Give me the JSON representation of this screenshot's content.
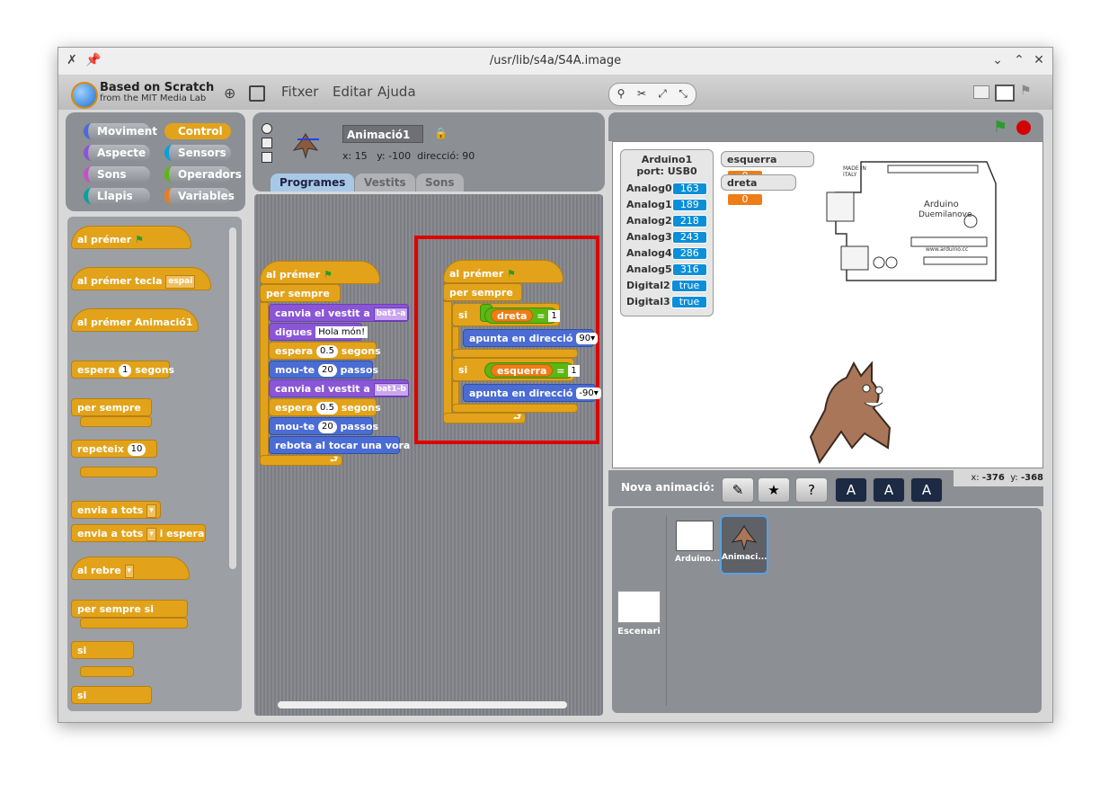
{
  "window": {
    "title": "/usr/lib/s4a/S4A.image"
  },
  "menu": {
    "brand_line1": "Based on Scratch",
    "brand_line2": "from the MIT Media Lab",
    "file": "Fitxer",
    "edit": "Editar",
    "help": "Ajuda"
  },
  "categories": {
    "motion": "Moviment",
    "control": "Control",
    "looks": "Aspecte",
    "sensing": "Sensors",
    "sound": "Sons",
    "operators": "Operadors",
    "pen": "Llapis",
    "variables": "Variables"
  },
  "palette": {
    "when_flag": "al prémer",
    "when_key": "al prémer tecla",
    "when_key_value": "espai",
    "when_clicked": "al prémer  Animació1",
    "wait_a": "espera",
    "wait_n": "1",
    "wait_b": "segons",
    "forever": "per sempre",
    "repeat": "repeteix",
    "repeat_n": "10",
    "broadcast": "envia a tots",
    "broadcast_wait_b": "i espera",
    "when_receive": "al rebre",
    "forever_if": "per sempre si",
    "if": "si"
  },
  "sprite_info": {
    "name": "Animació1",
    "x_label": "x:",
    "x": "15",
    "y_label": "y:",
    "y": "-100",
    "dir_label": "direcció:",
    "direction": "90"
  },
  "tabs": {
    "scripts": "Programes",
    "costumes": "Vestits",
    "sounds": "Sons"
  },
  "script1": {
    "hat": "al prémer",
    "forever": "per sempre",
    "costume1_a": "canvia el vestit a",
    "costume1_v": "bat1-a",
    "say_a": "digues",
    "say_v": "Hola món!",
    "wait1_a": "espera",
    "wait1_v": "0.5",
    "wait1_b": "segons",
    "move1_a": "mou-te",
    "move1_v": "20",
    "move1_b": "passos",
    "costume2_a": "canvia el vestit a",
    "costume2_v": "bat1-b",
    "wait2_a": "espera",
    "wait2_v": "0.5",
    "wait2_b": "segons",
    "move2_a": "mou-te",
    "move2_v": "20",
    "move2_b": "passos",
    "bounce": "rebota al tocar una vora"
  },
  "script2": {
    "hat": "al prémer",
    "forever": "per sempre",
    "if1": "si",
    "var1": "dreta",
    "eq1": "=",
    "val1": "1",
    "point1_a": "apunta en direcció",
    "point1_v": "90",
    "if2": "si",
    "var2": "esquerra",
    "eq2": "=",
    "val2": "1",
    "point2_a": "apunta en direcció",
    "point2_v": "-90"
  },
  "arduino_monitor": {
    "title1": "Arduino1",
    "title2": "port: USB0",
    "rows": [
      {
        "label": "Analog0",
        "value": "163"
      },
      {
        "label": "Analog1",
        "value": "189"
      },
      {
        "label": "Analog2",
        "value": "218"
      },
      {
        "label": "Analog3",
        "value": "243"
      },
      {
        "label": "Analog4",
        "value": "286"
      },
      {
        "label": "Analog5",
        "value": "316"
      },
      {
        "label": "Digital2",
        "value": "true"
      },
      {
        "label": "Digital3",
        "value": "true"
      }
    ]
  },
  "var_monitors": [
    {
      "label": "esquerra",
      "value": "0"
    },
    {
      "label": "dreta",
      "value": "0"
    }
  ],
  "stage_coords": {
    "x_label": "x:",
    "x": "-376",
    "y_label": "y:",
    "y": "-368"
  },
  "new_sprite_label": "Nova animació:",
  "sprites": [
    {
      "name": "Arduino..."
    },
    {
      "name": "Animaci..."
    }
  ],
  "stage_thumb_label": "Escenari",
  "arduino_board_text": {
    "made_in": "MADE IN ITALY",
    "brand": "Arduino",
    "model": "Duemilanove",
    "site": "www.arduino.cc"
  },
  "colors": {
    "control": "#e2a31b",
    "motion": "#4a6cd4",
    "looks": "#8a55d7",
    "operators": "#5cb712",
    "variables": "#ee7d16",
    "highlight": "#dd0000"
  }
}
